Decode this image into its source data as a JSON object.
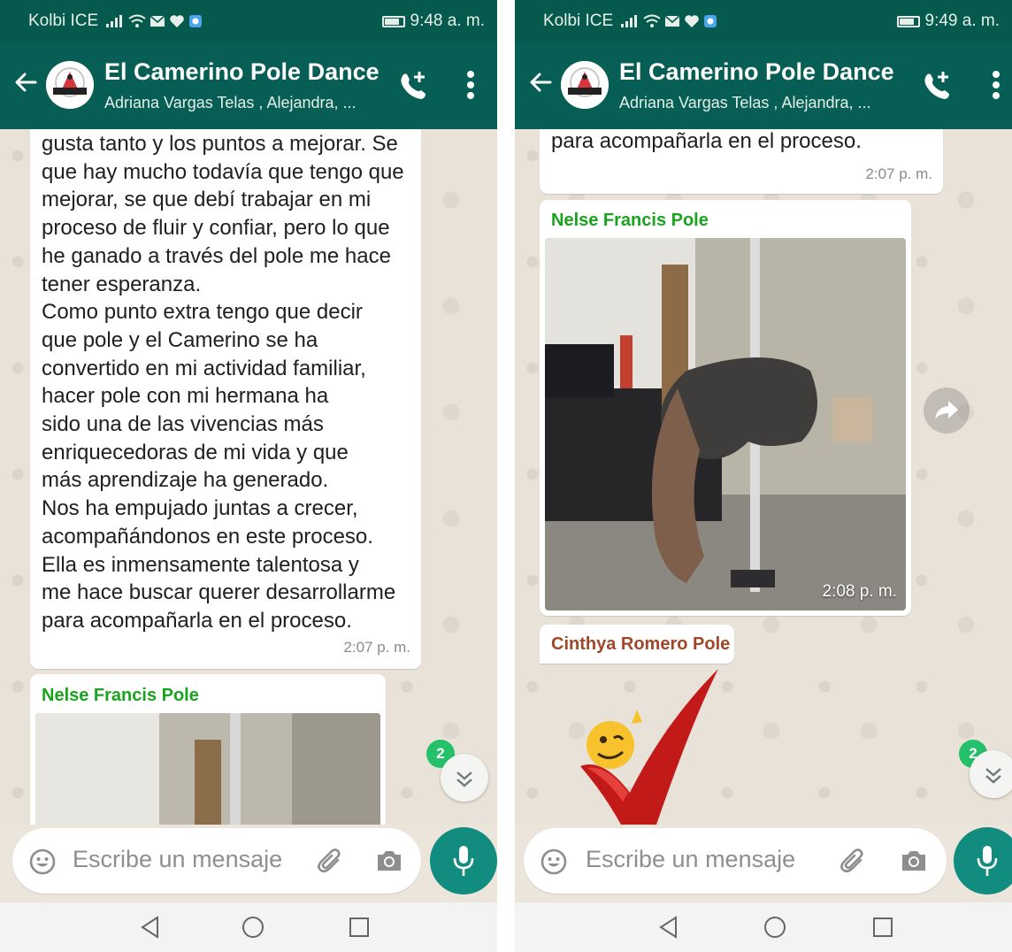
{
  "screens": [
    {
      "status": {
        "carrier": "Kolbi ICE",
        "time": "9:48 a. m."
      },
      "header": {
        "title": "El Camerino Pole Dance",
        "subtitle": "Adriana Vargas Telas , Alejandra, ..."
      },
      "messages": [
        {
          "text": "gusta tanto y los puntos a mejorar. Se\nque hay mucho todavía que tengo que\nmejorar, se que debí trabajar en mi\nproceso de fluir y confiar, pero lo que\nhe ganado a través del pole me hace\ntener esperanza.\nComo punto extra tengo que decir\nque pole y el Camerino se ha\nconvertido en mi actividad familiar,\nhacer pole con mi hermana ha\nsido una de las vivencias más\nenriquecedoras de mi vida y que\nmás aprendizaje ha generado.\nNos ha empujado juntas a crecer,\nacompañándonos en este proceso.\nElla es inmensamente talentosa y\nme hace buscar querer desarrollarme\npara acompañarla en el proceso.",
          "time": "2:07 p. m."
        },
        {
          "sender": "Nelse Francis Pole",
          "sender_color": "#1aa31e"
        }
      ],
      "unread_count": "2",
      "input": {
        "placeholder": "Escribe un mensaje"
      }
    },
    {
      "status": {
        "carrier": "Kolbi ICE",
        "time": "9:49 a. m."
      },
      "header": {
        "title": "El Camerino Pole Dance",
        "subtitle": "Adriana Vargas Telas , Alejandra, ..."
      },
      "messages": [
        {
          "text": "para acompañarla en el proceso.",
          "time": "2:07 p. m."
        },
        {
          "sender": "Nelse Francis Pole",
          "sender_color": "#1aa31e",
          "time": "2:08 p. m."
        },
        {
          "sender": "Cinthya Romero Pole",
          "sender_color": "#a0472a"
        }
      ],
      "unread_count": "2",
      "input": {
        "placeholder": "Escribe un mensaje"
      }
    }
  ],
  "theme": {
    "header": "#075e54",
    "statusbar": "#06594d",
    "accent": "#128c7e",
    "badge": "#25c16a"
  },
  "icons": [
    "back-arrow-icon",
    "add-call-icon",
    "more-vert-icon",
    "emoji-icon",
    "attach-icon",
    "camera-icon",
    "mic-icon",
    "scroll-down-icon",
    "forward-icon",
    "nav-back-icon",
    "nav-home-icon",
    "nav-recents-icon"
  ]
}
